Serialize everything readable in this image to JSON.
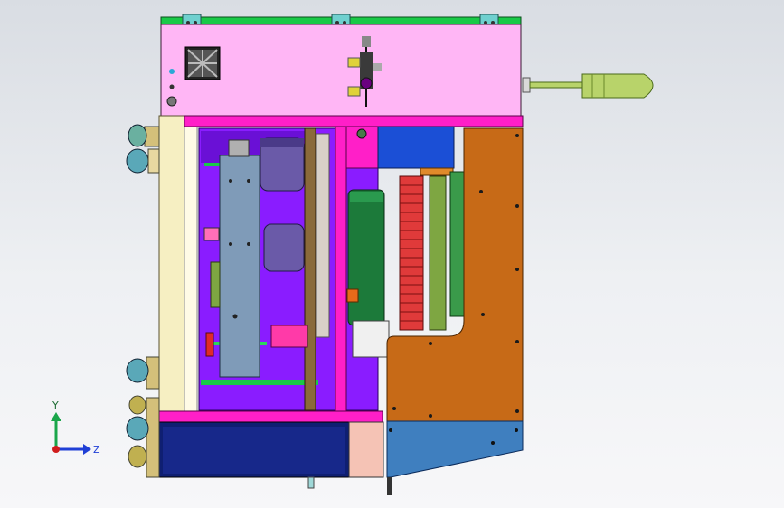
{
  "viewport": {
    "background_top": "#d9dde3",
    "background_bottom": "#f7f7f9"
  },
  "triad": {
    "y_label": "Y",
    "z_label": "Z",
    "y_axis_color": "#1aa64a",
    "z_axis_color": "#1f3fd6",
    "origin_color": "#d01c1c"
  },
  "model": {
    "palette": {
      "top_panel": "#ffb6f5",
      "frame_magenta": "#ff1fc8",
      "inner_purple": "#8a1cff",
      "blue_block": "#1b4fd6",
      "orange_panel": "#c76a17",
      "gray_blue_part": "#7f9bb8",
      "green_rail": "#19c947",
      "olive_green": "#7ea642",
      "cream_side": "#f6efc2",
      "handle_green": "#b8d36a",
      "navy_box": "#0f1f72",
      "steel_blue_base": "#3f7fbf"
    }
  }
}
